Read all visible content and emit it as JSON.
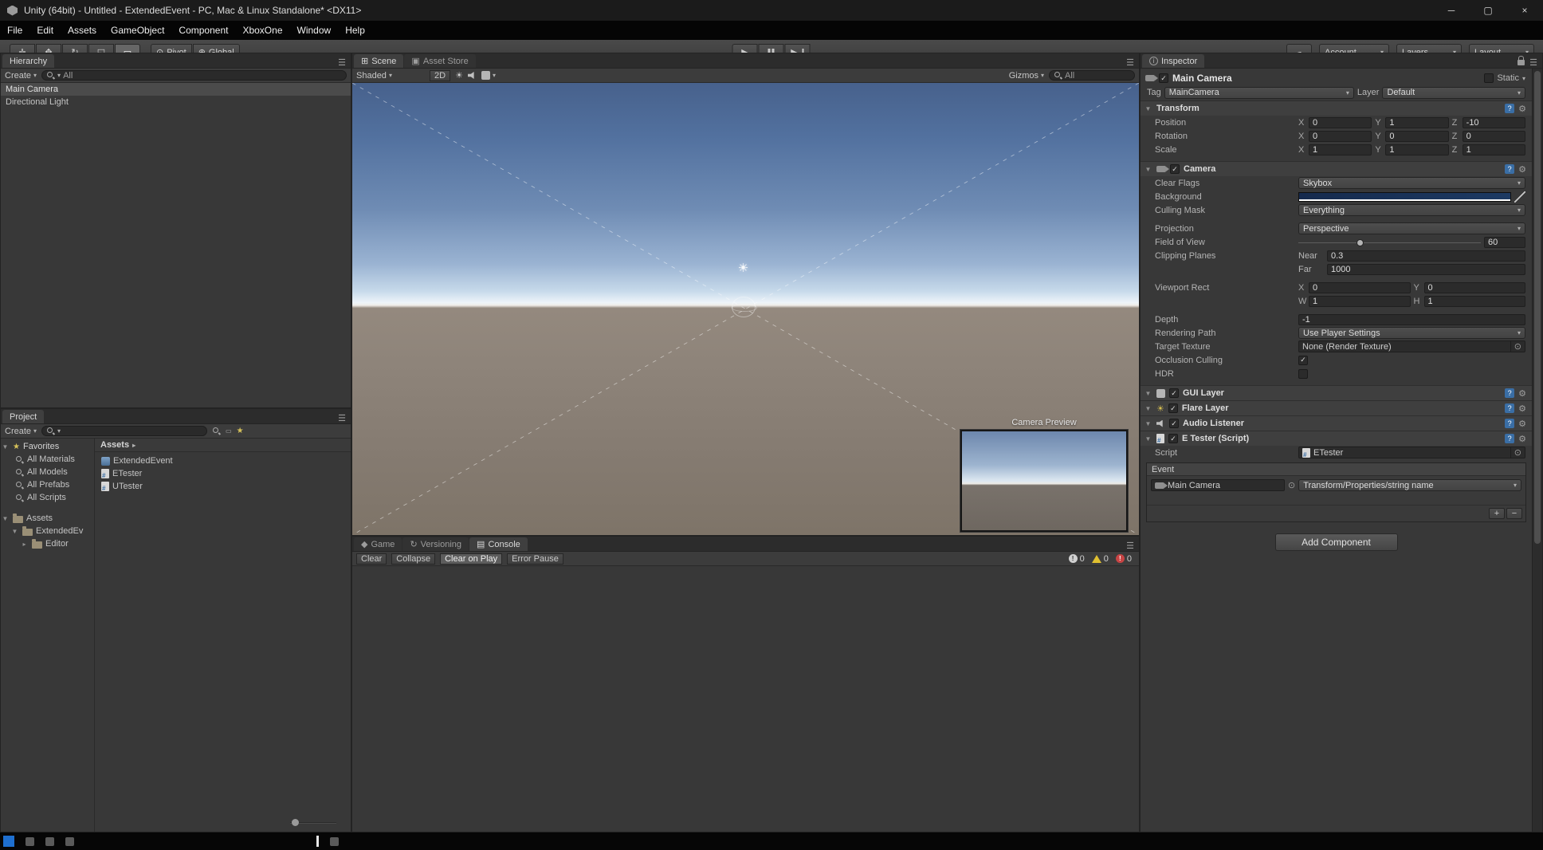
{
  "icons": {
    "caret": "▾",
    "fold_open": "▼",
    "fold_closed": "▸",
    "hamburger": "☰",
    "check": "✓",
    "star": "★",
    "cloud": "☁",
    "gear": "⚙",
    "play": "▶",
    "sun": "☀",
    "minimize": "─",
    "maximize": "▢",
    "close": "×",
    "pivot": "⊙",
    "global": "⊕",
    "pan_tool": "✛",
    "move_tool": "✥",
    "rotate_tool": "↻",
    "scale_tool": "◱",
    "rect_tool": "▭",
    "grid": "⊞",
    "store": "▣",
    "picker": "⊙",
    "plus": "+",
    "minus": "−",
    "game": "◆",
    "versioning": "↻",
    "console": "▤",
    "help": "?",
    "exclaim": "!",
    "script_hash": "#",
    "info_letter": "i"
  },
  "window": {
    "title": "Unity (64bit) - Untitled - ExtendedEvent - PC, Mac & Linux Standalone* <DX11>"
  },
  "menu": {
    "items": [
      "File",
      "Edit",
      "Assets",
      "GameObject",
      "Component",
      "XboxOne",
      "Window",
      "Help"
    ]
  },
  "toolbar": {
    "pivot": "Pivot",
    "global": "Global",
    "account": "Account",
    "layers": "Layers",
    "layout": "Layout"
  },
  "hierarchy": {
    "tab": "Hierarchy",
    "create": "Create",
    "search_value": "All",
    "items": [
      {
        "label": "Main Camera"
      },
      {
        "label": "Directional Light"
      }
    ]
  },
  "project": {
    "tab": "Project",
    "create": "Create",
    "favorites_label": "Favorites",
    "favorites": [
      "All Materials",
      "All Models",
      "All Prefabs",
      "All Scripts"
    ],
    "tree": [
      {
        "label": "Assets"
      },
      {
        "label": "ExtendedEv"
      },
      {
        "label": "Editor"
      }
    ],
    "breadcrumb": "Assets",
    "files": [
      {
        "label": "ExtendedEvent"
      },
      {
        "label": "ETester"
      },
      {
        "label": "UTester"
      }
    ]
  },
  "scene": {
    "tab_scene": "Scene",
    "tab_asset_store": "Asset Store",
    "shaded": "Shaded",
    "toggle_2d": "2D",
    "gizmos": "Gizmos",
    "search_value": "All",
    "camera_preview_label": "Camera Preview"
  },
  "console": {
    "tab_game": "Game",
    "tab_versioning": "Versioning",
    "tab_console": "Console",
    "clear": "Clear",
    "collapse": "Collapse",
    "clear_on_play": "Clear on Play",
    "error_pause": "Error Pause",
    "info_count": "0",
    "warning_count": "0",
    "error_count": "0"
  },
  "inspector": {
    "tab": "Inspector",
    "name": "Main Camera",
    "static_label": "Static",
    "tag_label": "Tag",
    "tag_value": "MainCamera",
    "layer_label": "Layer",
    "layer_value": "Default",
    "axes": {
      "x": "X",
      "y": "Y",
      "z": "Z",
      "w": "W",
      "h": "H"
    },
    "transform": {
      "title": "Transform",
      "position": {
        "label": "Position",
        "x": "0",
        "y": "1",
        "z": "-10"
      },
      "rotation": {
        "label": "Rotation",
        "x": "0",
        "y": "0",
        "z": "0"
      },
      "scale": {
        "label": "Scale",
        "x": "1",
        "y": "1",
        "z": "1"
      }
    },
    "camera": {
      "title": "Camera",
      "clear_flags_label": "Clear Flags",
      "clear_flags_value": "Skybox",
      "background_label": "Background",
      "culling_mask_label": "Culling Mask",
      "culling_mask_value": "Everything",
      "projection_label": "Projection",
      "projection_value": "Perspective",
      "fov_label": "Field of View",
      "fov_value": "60",
      "clipping_label": "Clipping Planes",
      "near_label": "Near",
      "near_value": "0.3",
      "far_label": "Far",
      "far_value": "1000",
      "viewport_label": "Viewport Rect",
      "viewport_x": "0",
      "viewport_y": "0",
      "viewport_w": "1",
      "viewport_h": "1",
      "depth_label": "Depth",
      "depth_value": "-1",
      "rendering_path_label": "Rendering Path",
      "rendering_path_value": "Use Player Settings",
      "target_texture_label": "Target Texture",
      "target_texture_value": "None (Render Texture)",
      "occlusion_label": "Occlusion Culling",
      "hdr_label": "HDR"
    },
    "gui_layer": "GUI Layer",
    "flare_layer": "Flare Layer",
    "audio_listener": "Audio Listener",
    "etester": {
      "title": "E Tester (Script)",
      "script_label": "Script",
      "script_value": "ETester",
      "event_label": "Event",
      "target_value": "Main Camera",
      "method_value": "Transform/Properties/string name"
    },
    "add_component": "Add Component"
  },
  "colors": {
    "camera_background": "#1d3a63",
    "sky_top": "#47618c",
    "ground": "#8a7f75",
    "warning_yellow": "#e0c030",
    "error_red": "#c84444",
    "taskbar_accent": "#1e6fd0"
  }
}
